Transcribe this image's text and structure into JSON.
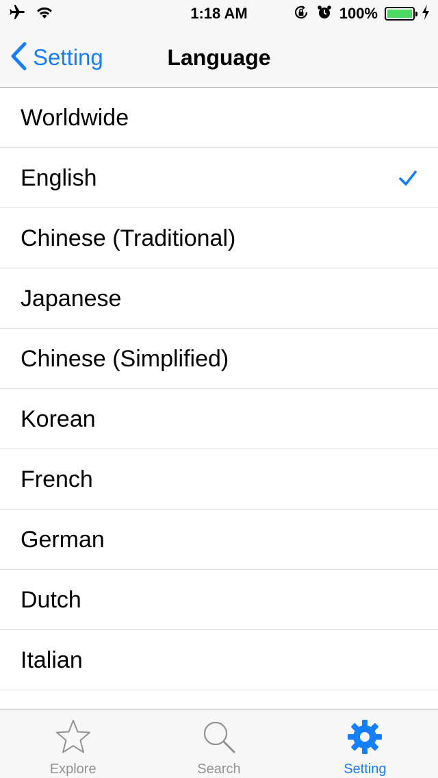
{
  "status_bar": {
    "time": "1:18 AM",
    "battery_percent": "100%",
    "battery_level": 1.0,
    "icons": [
      "airplane-icon",
      "wifi-icon",
      "rotation-lock-icon",
      "alarm-icon",
      "battery-icon",
      "charging-icon"
    ]
  },
  "nav": {
    "back_label": "Setting",
    "title": "Language"
  },
  "languages": {
    "items": [
      {
        "label": "Worldwide",
        "selected": false
      },
      {
        "label": "English",
        "selected": true
      },
      {
        "label": "Chinese (Traditional)",
        "selected": false
      },
      {
        "label": "Japanese",
        "selected": false
      },
      {
        "label": "Chinese (Simplified)",
        "selected": false
      },
      {
        "label": "Korean",
        "selected": false
      },
      {
        "label": "French",
        "selected": false
      },
      {
        "label": "German",
        "selected": false
      },
      {
        "label": "Dutch",
        "selected": false
      },
      {
        "label": "Italian",
        "selected": false
      }
    ]
  },
  "tabs": [
    {
      "label": "Explore",
      "icon": "star-icon",
      "active": false
    },
    {
      "label": "Search",
      "icon": "search-icon",
      "active": false
    },
    {
      "label": "Setting",
      "icon": "gear-icon",
      "active": true
    }
  ],
  "colors": {
    "accent": "#157efb",
    "inactive": "#929292",
    "battery": "#4cd964"
  }
}
